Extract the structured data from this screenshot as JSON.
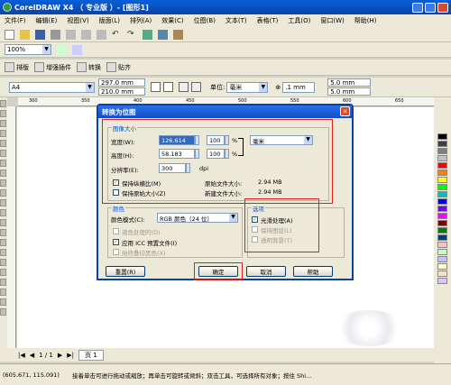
{
  "window": {
    "title": "CorelDRAW X4 （ 专业版 ）- [图形1]"
  },
  "menu": [
    "文件(F)",
    "编辑(E)",
    "视图(V)",
    "版面(L)",
    "排列(A)",
    "效果(C)",
    "位图(B)",
    "文本(T)",
    "表格(T)",
    "工具(O)",
    "窗口(W)",
    "帮助(H)"
  ],
  "toolbar": {
    "zoom": "100%"
  },
  "plugins": {
    "layout": "排版",
    "enhance": "增强插件",
    "convert": "转换",
    "paste": "贴齐"
  },
  "property_bar": {
    "paper": "A4",
    "width": "297.0 mm",
    "height": "210.0 mm",
    "units_label": "单位:",
    "units": "毫米",
    "nudge": ".1 mm",
    "dup_x": "5.0 mm",
    "dup_y": "5.0 mm"
  },
  "ruler": {
    "marks": [
      "300",
      "350",
      "400",
      "450",
      "500",
      "550",
      "600",
      "650"
    ]
  },
  "dialog": {
    "title": "转换为位图",
    "size_group": "图像大小",
    "width_label": "宽度(W):",
    "width_value": "126.614",
    "width_pct": "100",
    "pct_symbol": "%",
    "height_label": "高度(H):",
    "height_value": "58.183",
    "height_pct": "100",
    "units": "毫米",
    "resolution_label": "分辨率(E):",
    "resolution_value": "300",
    "resolution_unit": "dpi",
    "keep_ratio": "保持纵横比(M)",
    "keep_size": "保持原始大小(Z)",
    "orig_size_label": "原始文件大小:",
    "orig_size": "2.94 MB",
    "new_size_label": "新建文件大小:",
    "new_size": "2.94 MB",
    "color_group": "颜色",
    "color_mode_label": "颜色模式(C):",
    "color_mode": "RGB 颜色（24 位）",
    "dither": "递色处理的(D)",
    "icc": "应用 ICC 预置文件(I)",
    "always_overprint": "始终叠印黑色(X)",
    "options_group": "选项",
    "antialias": "光滑处理(A)",
    "keep_layers": "保持图层(L)",
    "transparent_bg": "透明背景(T)",
    "reset": "重置(R)",
    "ok": "确定",
    "cancel": "取消",
    "help": "帮助"
  },
  "pagebar": {
    "counter": "1 / 1",
    "page": "页 1"
  },
  "status": {
    "coords": "(605.671, 115.091)",
    "hint": "接着单击可进行拖动或缩放；再单击可旋转或倾斜；双击工具，可选择所有对象；按住 Shi..."
  },
  "palette": [
    "#000000",
    "#404040",
    "#808080",
    "#c0c0c0",
    "#ff0000",
    "#ff8000",
    "#ffff00",
    "#00ff00",
    "#00c0c0",
    "#0000ff",
    "#8000ff",
    "#ff00ff",
    "#800000",
    "#008000",
    "#004080",
    "#ffc0c0",
    "#c0ffc0",
    "#c0c0ff",
    "#ffffc0",
    "#ffe0c0",
    "#e0c0ff"
  ]
}
